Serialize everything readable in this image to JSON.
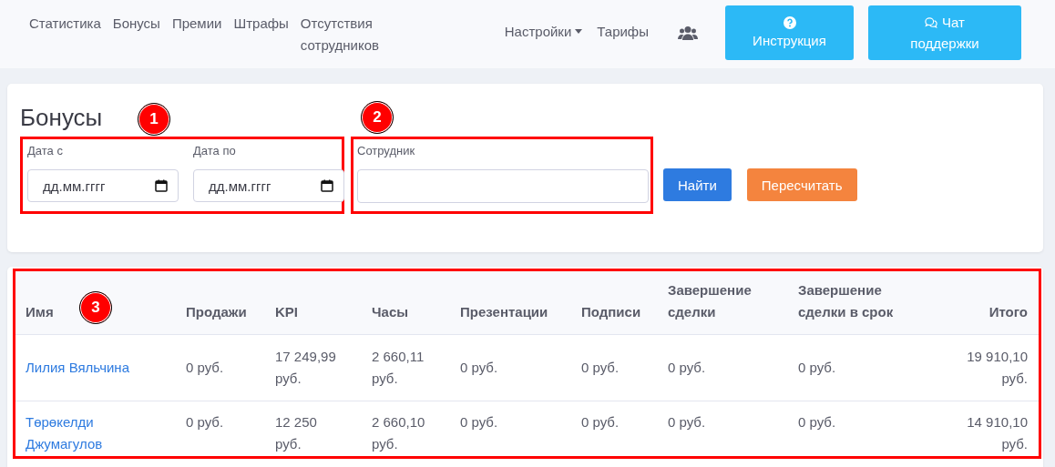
{
  "nav": {
    "links": [
      {
        "label": "Статистика"
      },
      {
        "label": "Бонусы"
      },
      {
        "label": "Премии"
      },
      {
        "label": "Штрафы"
      },
      {
        "label": "Отсутствия сотрудников"
      }
    ],
    "settings": "Настройки",
    "tariffs": "Тарифы",
    "buttons": [
      {
        "label": "Инструкция"
      },
      {
        "label": "Чат поддержки"
      }
    ]
  },
  "filters": {
    "title": "Бонусы",
    "date_from": {
      "label": "Дата с",
      "placeholder": "дд.мм.гггг"
    },
    "date_to": {
      "label": "Дата по",
      "placeholder": "дд.мм.гггг"
    },
    "employee": {
      "label": "Сотрудник"
    },
    "find_button": "Найти",
    "recalc_button": "Пересчитать"
  },
  "table": {
    "columns": [
      "Имя",
      "Продажи",
      "KPI",
      "Часы",
      "Презентации",
      "Подписи",
      "Завершение сделки",
      "Завершение сделки в срок",
      "Итого"
    ],
    "rows": [
      {
        "cells": [
          "Лилия Вяльчина",
          "0 руб.",
          "17 249,99 руб.",
          "2 660,11 руб.",
          "0 руб.",
          "0 руб.",
          "0 руб.",
          "0 руб.",
          "19 910,10 руб."
        ]
      },
      {
        "cells": [
          "Төрөкелди Джумагулов",
          "0 руб.",
          "12 250 руб.",
          "2 660,10 руб.",
          "0 руб.",
          "0 руб.",
          "0 руб.",
          "0 руб.",
          "14 910,10 руб."
        ]
      }
    ]
  },
  "callouts": [
    {
      "label": "1"
    },
    {
      "label": "2"
    },
    {
      "label": "3"
    }
  ]
}
